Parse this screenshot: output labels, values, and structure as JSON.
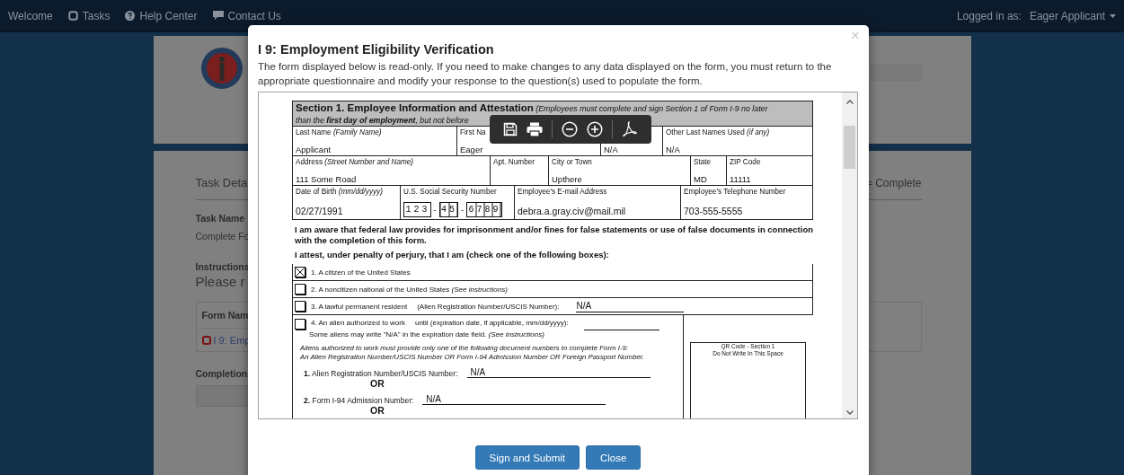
{
  "nav": {
    "links": [
      {
        "label": "Welcome"
      },
      {
        "label": "Tasks"
      },
      {
        "label": "Help Center"
      },
      {
        "label": "Contact Us"
      }
    ],
    "user_label": "Logged in as:",
    "user_name": "Eager Applicant"
  },
  "background": {
    "task_heading": "Task Deta",
    "legend": "= Complete",
    "task_name_label": "Task Name",
    "task_name": "Complete Fo",
    "instructions_label": "Instructions",
    "instructions": "Please r",
    "table_header": "Form Nam",
    "table_row": "I 9: Emp",
    "completion_label": "Completion"
  },
  "modal": {
    "close": "×",
    "title": "I 9: Employment Eligibility Verification",
    "description": "The form displayed below is read-only. If you need to make changes to any data displayed on the form, you must return to the appropriate questionnaire and modify your response to the question(s) used to populate the form.",
    "document": {
      "section_heading": "Section 1. Employee Information and Attestation",
      "section_note": [
        "(Employees must complete and sign Section 1 of Form I-9 no later",
        "than the **first day of employment**, but not before"
      ],
      "rows": [
        [
          {
            "label": "Last Name *(Family Name)*",
            "value": "Applicant"
          },
          {
            "label": "First Na",
            "value": "Eager"
          },
          {
            "value": "N/A"
          },
          {
            "label": "Other Last Names Used *(if any)*",
            "value": "N/A"
          }
        ],
        [
          {
            "label": "Address *(Street Number and Name)*",
            "value": "111 Some Road"
          },
          {
            "label": "Apt. Number"
          },
          {
            "label": "City or Town",
            "value": "Upthere"
          },
          {
            "label": "State",
            "value": "MD"
          },
          {
            "label": "ZIP Code",
            "value": "11111"
          }
        ],
        [
          {
            "label": "Date of Birth *(mm/dd/yyyy)*",
            "value": "02/27/1991"
          },
          {
            "label": "U.S. Social Security Number",
            "ssn": [
              {
                "kind": "digits",
                "text": "123"
              },
              {
                "kind": "dash",
                "text": "-"
              },
              {
                "kind": "digits",
                "text": "45"
              },
              {
                "kind": "dash",
                "text": "-"
              },
              {
                "kind": "digits",
                "text": "6789"
              }
            ]
          },
          {
            "label": "Employee's E-mail Address",
            "value": "debra.a.gray.civ@mail.mil"
          },
          {
            "label": "Employee's Telephone Number",
            "value": "703-555-5555"
          }
        ]
      ],
      "statement": "I am aware that federal law provides for imprisonment and/or fines for false statements or use of false documents in connection with the completion of this form.",
      "attest": "I attest, under penalty of perjury, that I am (check one of the following boxes):",
      "options": [
        {
          "text": "1. A citizen of the United States",
          "checked": true
        },
        {
          "text": "2. A noncitizen national of the United States *(See instructions)*",
          "checked": false
        },
        {
          "text": "3. A lawful permanent resident",
          "detail": "(Alien Registration Number/USCIS Number):",
          "value": "N/A",
          "checked": false
        },
        {
          "text": "4. An alien authorized to work",
          "detail": "until (expiration date, if applicable, mm/dd/yyyy):",
          "note": "Some aliens may write \"N/A\" in the expiration date field.  *(See instructions)*",
          "checked": false
        }
      ],
      "alien_instructions": [
        "Aliens authorized to work must provide only one of the following document numbers to complete Form I-9:",
        "An Alien Registration Number/USCIS Number OR Form I-94 Admission Number OR Foreign Passport Number."
      ],
      "doc_numbers": [
        {
          "label": "**1.** Alien Registration Number/USCIS Number:",
          "value": "N/A",
          "separator": "OR"
        },
        {
          "label": "**2.** Form I-94 Admission Number:",
          "value": "N/A",
          "separator": "OR"
        }
      ],
      "qr_box": [
        "QR Code - Section 1",
        "Do Not Write In This Space"
      ]
    },
    "buttons": [
      {
        "label": "Sign and Submit",
        "kind": "primary"
      },
      {
        "label": "Close",
        "kind": "primary"
      }
    ]
  }
}
